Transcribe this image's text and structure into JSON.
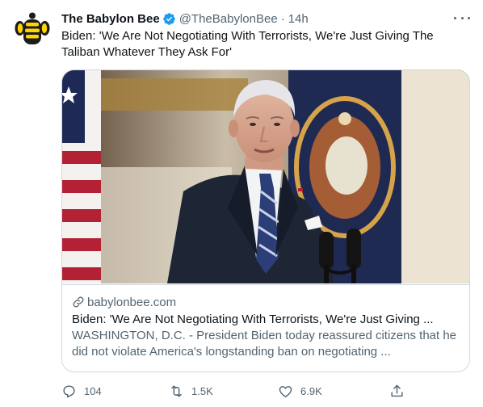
{
  "tweet": {
    "author_name": "The Babylon Bee",
    "handle": "@TheBabylonBee",
    "separator": "·",
    "time": "14h",
    "verified": true,
    "avatar_icon": "bee-logo-icon",
    "text": "Biden: 'We Are Not Negotiating With Terrorists, We're Just Giving The Taliban Whatever They Ask For'"
  },
  "card": {
    "image_icon": "man-at-podium-photo",
    "domain": "babylonbee.com",
    "title": "Biden: 'We Are Not Negotiating With Terrorists, We're Just Giving ...",
    "description": "WASHINGTON, D.C. - President Biden today reassured citizens that he did not violate America's longstanding ban on negotiating ..."
  },
  "actions": {
    "reply_count": "104",
    "retweet_count": "1.5K",
    "like_count": "6.9K"
  },
  "colors": {
    "text_primary": "#0f1419",
    "text_secondary": "#536471",
    "verified_blue": "#1d9bf0",
    "border": "#cfd9de",
    "bee_black": "#1c1c1c",
    "bee_yellow": "#ffd400"
  }
}
